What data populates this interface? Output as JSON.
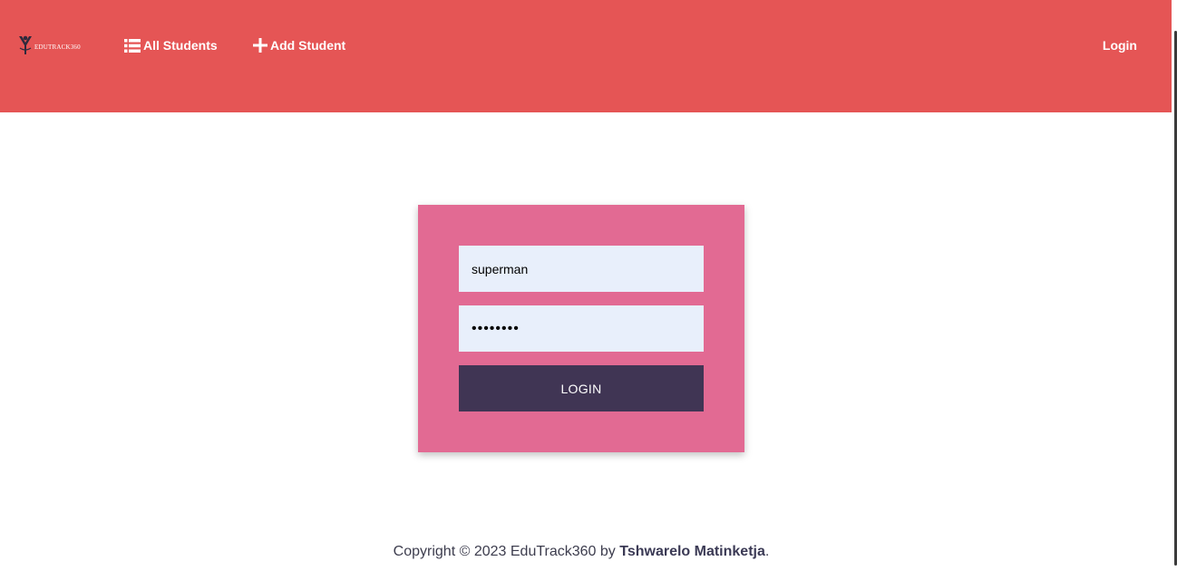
{
  "header": {
    "logo_text": "EDUTRACK360",
    "nav": {
      "all_students": "All Students",
      "add_student": "Add Student",
      "login": "Login"
    }
  },
  "login_form": {
    "username_value": "superman",
    "password_value": "••••••••",
    "submit_label": "LOGIN"
  },
  "footer": {
    "prefix": "Copyright © 2023 EduTrack360 by ",
    "author": "Tshwarelo Matinketja",
    "suffix": "."
  },
  "colors": {
    "header_bg": "#e55555",
    "card_bg": "#e26a93",
    "input_bg": "#e8effb",
    "button_bg": "#403554"
  },
  "icons": {
    "all_students": "list-icon",
    "add_student": "plus-icon"
  }
}
